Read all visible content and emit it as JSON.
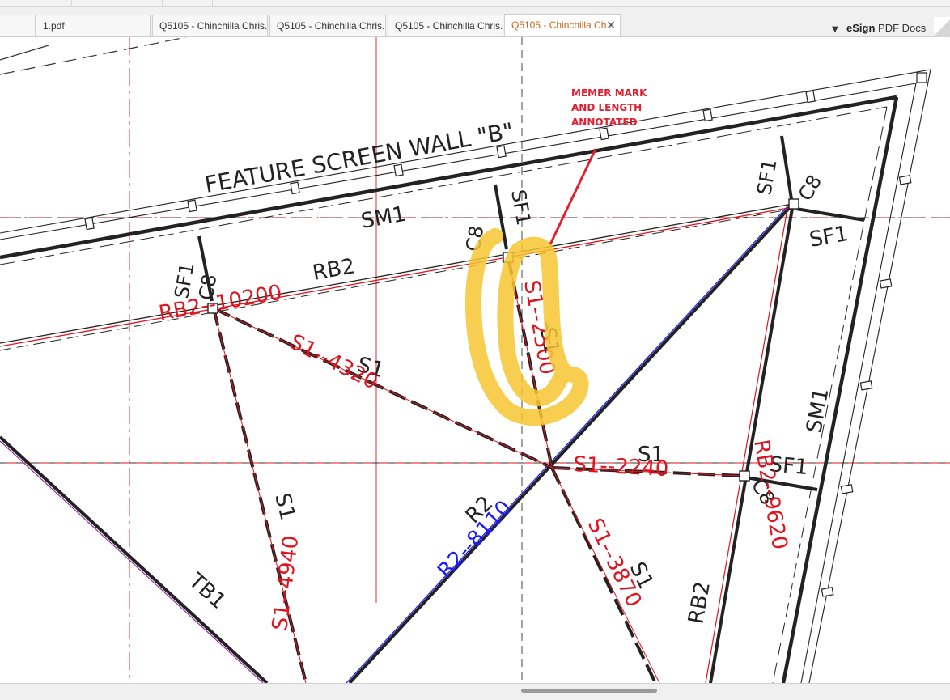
{
  "tabs": [
    {
      "label": "1.pdf",
      "active": false
    },
    {
      "label": "Q5105 - Chinchilla Chris...",
      "active": false
    },
    {
      "label": "Q5105 - Chinchilla Chris...",
      "active": false
    },
    {
      "label": "Q5105 - Chinchilla Chris...",
      "active": false
    },
    {
      "label": "Q5105 - Chinchilla Ch...",
      "active": true
    }
  ],
  "tab_close_glyph": "✕",
  "tab_menu_glyph": "▼",
  "brand": {
    "bold": "eSign",
    "rest": " PDF Docs"
  },
  "drawing": {
    "wall_title": "FEATURE SCREEN WALL \"B\"",
    "labels_black": {
      "sm1_top": "SM1",
      "rb2_top": "RB2",
      "sf1_left": "SF1",
      "c8_left": "C8",
      "c8_mid": "C8",
      "sf1_mid": "SF1",
      "sf1_right_top": "SF1",
      "c8_right_top": "C8",
      "sf1_right2": "SF1",
      "s1_center_left": "S1",
      "s1_center_mid": "S1",
      "sm1_right": "SM1",
      "s1_right": "S1",
      "sf1_right3": "SF1",
      "c8_lower_right": "C8",
      "s1_lower_left": "S1",
      "r2_lower": "R2",
      "s1_lower_right": "S1",
      "tb1": "TB1",
      "rb2_bottom": "RB2"
    },
    "labels_red": {
      "rb2_10200": "RB2--10200",
      "s1_4320": "S1--4320",
      "s1_2500": "S1--2500",
      "s1_2240": "S1--2240",
      "rb2_9620": "RB2--9620",
      "s1_4940": "S1--4940",
      "s1_3870": "S1--3870"
    },
    "labels_blue": {
      "r2_8110": "R2--8110"
    },
    "annotation": [
      "MEMER MARK",
      "AND LENGTH",
      "ANNOTATED"
    ],
    "colors": {
      "ink": "#222222",
      "red": "#e0141e",
      "blue": "#1a1aff",
      "highlight": "#f7c531",
      "annotation": "#e02030",
      "active_tab": "#c8661a"
    }
  }
}
